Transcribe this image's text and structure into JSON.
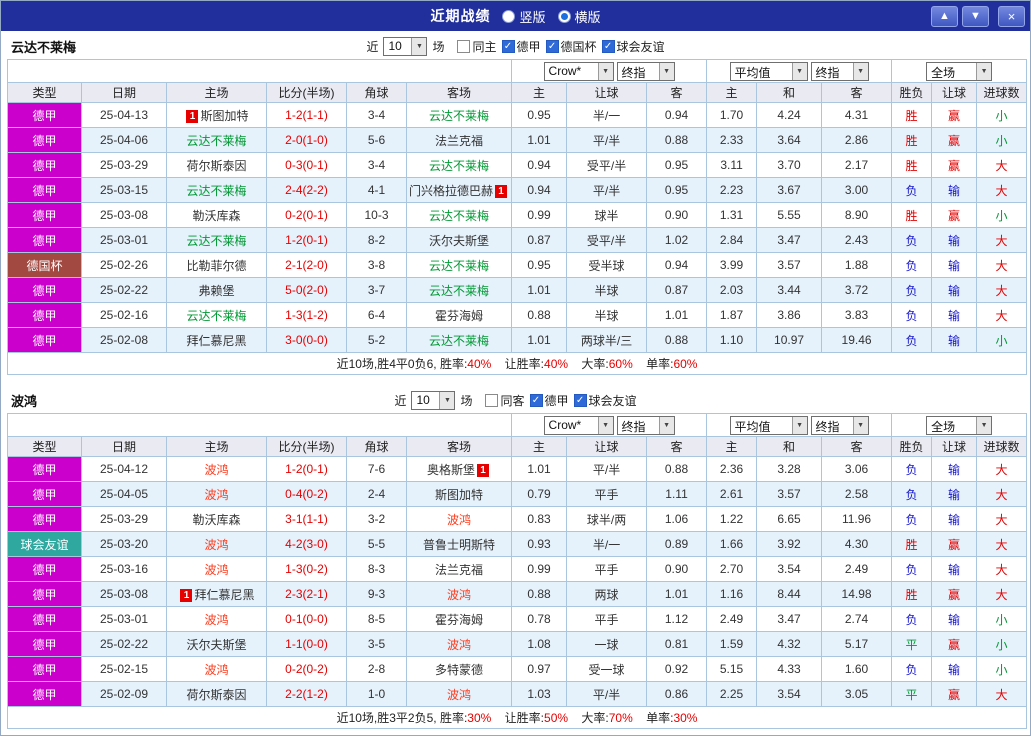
{
  "titlebar": {
    "title": "近期战绩",
    "vertical_label": "竖版",
    "horizontal_label": "横版",
    "up_icon": "▲",
    "down_icon": "▼",
    "close_icon": "×"
  },
  "filter_labels": {
    "recent": "近",
    "matches": "场"
  },
  "dropdowns": {
    "company": "Crow*",
    "stage": "终指",
    "average": "平均值",
    "stage2": "终指",
    "scope": "全场"
  },
  "columns": [
    "类型",
    "日期",
    "主场",
    "比分(半场)",
    "角球",
    "客场",
    "主",
    "让球",
    "客",
    "主",
    "和",
    "客",
    "胜负",
    "让球",
    "进球数"
  ],
  "colors": {
    "titlebar_bg": "#202f9b",
    "types": {
      "德甲": "#cc00cc",
      "德国杯": "#a24a42",
      "球会友谊": "#2fa8a0"
    },
    "score": "#e60000",
    "result": {
      "胜": "#e60000",
      "平": "#009933",
      "负": "#1515cc"
    },
    "cover": {
      "赢": "#e60000",
      "输": "#1515cc"
    },
    "goals": {
      "大": "#e60000",
      "小": "#009933"
    }
  },
  "sections": [
    {
      "team": "云达不莱梅",
      "team_color": "#009933",
      "recent_count": "10",
      "same_label": "同主",
      "leagues": [
        "德甲",
        "德国杯",
        "球会友谊"
      ],
      "rows": [
        {
          "type": "德甲",
          "date": "25-04-13",
          "home": "斯图加特",
          "home_badge": "1",
          "home_badge_pos": "before",
          "score": "1-2(1-1)",
          "corners": "3-4",
          "away": "云达不莱梅",
          "away_hl": true,
          "hcap_home": "0.95",
          "hcap_line": "半/一",
          "hcap_away": "0.94",
          "avg_home": "1.70",
          "avg_draw": "4.24",
          "avg_away": "4.31",
          "result": "胜",
          "hcap_result": "赢",
          "goals": "小"
        },
        {
          "type": "德甲",
          "date": "25-04-06",
          "home": "云达不莱梅",
          "home_hl": true,
          "score": "2-0(1-0)",
          "corners": "5-6",
          "away": "法兰克福",
          "hcap_home": "1.01",
          "hcap_line": "平/半",
          "hcap_away": "0.88",
          "avg_home": "2.33",
          "avg_draw": "3.64",
          "avg_away": "2.86",
          "result": "胜",
          "hcap_result": "赢",
          "goals": "小"
        },
        {
          "type": "德甲",
          "date": "25-03-29",
          "home": "荷尔斯泰因",
          "score": "0-3(0-1)",
          "corners": "3-4",
          "away": "云达不莱梅",
          "away_hl": true,
          "hcap_home": "0.94",
          "hcap_line": "受平/半",
          "hcap_away": "0.95",
          "avg_home": "3.11",
          "avg_draw": "3.70",
          "avg_away": "2.17",
          "result": "胜",
          "hcap_result": "赢",
          "goals": "大"
        },
        {
          "type": "德甲",
          "date": "25-03-15",
          "home": "云达不莱梅",
          "home_hl": true,
          "score": "2-4(2-2)",
          "corners": "4-1",
          "away": "门兴格拉德巴赫",
          "away_badge": "1",
          "away_badge_pos": "after",
          "hcap_home": "0.94",
          "hcap_line": "平/半",
          "hcap_away": "0.95",
          "avg_home": "2.23",
          "avg_draw": "3.67",
          "avg_away": "3.00",
          "result": "负",
          "hcap_result": "输",
          "goals": "大"
        },
        {
          "type": "德甲",
          "date": "25-03-08",
          "home": "勒沃库森",
          "score": "0-2(0-1)",
          "corners": "10-3",
          "away": "云达不莱梅",
          "away_hl": true,
          "hcap_home": "0.99",
          "hcap_line": "球半",
          "hcap_away": "0.90",
          "avg_home": "1.31",
          "avg_draw": "5.55",
          "avg_away": "8.90",
          "result": "胜",
          "hcap_result": "赢",
          "goals": "小"
        },
        {
          "type": "德甲",
          "date": "25-03-01",
          "home": "云达不莱梅",
          "home_hl": true,
          "score": "1-2(0-1)",
          "corners": "8-2",
          "away": "沃尔夫斯堡",
          "hcap_home": "0.87",
          "hcap_line": "受平/半",
          "hcap_away": "1.02",
          "avg_home": "2.84",
          "avg_draw": "3.47",
          "avg_away": "2.43",
          "result": "负",
          "hcap_result": "输",
          "goals": "大"
        },
        {
          "type": "德国杯",
          "date": "25-02-26",
          "home": "比勒菲尔德",
          "score": "2-1(2-0)",
          "corners": "3-8",
          "away": "云达不莱梅",
          "away_hl": true,
          "hcap_home": "0.95",
          "hcap_line": "受半球",
          "hcap_away": "0.94",
          "avg_home": "3.99",
          "avg_draw": "3.57",
          "avg_away": "1.88",
          "result": "负",
          "hcap_result": "输",
          "goals": "大"
        },
        {
          "type": "德甲",
          "date": "25-02-22",
          "home": "弗赖堡",
          "score": "5-0(2-0)",
          "corners": "3-7",
          "away": "云达不莱梅",
          "away_hl": true,
          "hcap_home": "1.01",
          "hcap_line": "半球",
          "hcap_away": "0.87",
          "avg_home": "2.03",
          "avg_draw": "3.44",
          "avg_away": "3.72",
          "result": "负",
          "hcap_result": "输",
          "goals": "大"
        },
        {
          "type": "德甲",
          "date": "25-02-16",
          "home": "云达不莱梅",
          "home_hl": true,
          "score": "1-3(1-2)",
          "corners": "6-4",
          "away": "霍芬海姆",
          "hcap_home": "0.88",
          "hcap_line": "半球",
          "hcap_away": "1.01",
          "avg_home": "1.87",
          "avg_draw": "3.86",
          "avg_away": "3.83",
          "result": "负",
          "hcap_result": "输",
          "goals": "大"
        },
        {
          "type": "德甲",
          "date": "25-02-08",
          "home": "拜仁慕尼黑",
          "score": "3-0(0-0)",
          "corners": "5-2",
          "away": "云达不莱梅",
          "away_hl": true,
          "hcap_home": "1.01",
          "hcap_line": "两球半/三",
          "hcap_away": "0.88",
          "avg_home": "1.10",
          "avg_draw": "10.97",
          "avg_away": "19.46",
          "result": "负",
          "hcap_result": "输",
          "goals": "小"
        }
      ],
      "summary": {
        "p1": "近10场,胜4平0负6, 胜率:",
        "v1": "40%",
        "p2": "让胜率:",
        "v2": "40%",
        "p3": "大率:",
        "v3": "60%",
        "p4": "单率:",
        "v4": "60%"
      }
    },
    {
      "team": "波鸿",
      "team_color": "#ff3a1a",
      "recent_count": "10",
      "same_label": "同客",
      "leagues": [
        "德甲",
        "球会友谊"
      ],
      "rows": [
        {
          "type": "德甲",
          "date": "25-04-12",
          "home": "波鸿",
          "home_hl": true,
          "score": "1-2(0-1)",
          "corners": "7-6",
          "away": "奥格斯堡",
          "away_badge": "1",
          "away_badge_pos": "after",
          "hcap_home": "1.01",
          "hcap_line": "平/半",
          "hcap_away": "0.88",
          "avg_home": "2.36",
          "avg_draw": "3.28",
          "avg_away": "3.06",
          "result": "负",
          "hcap_result": "输",
          "goals": "大"
        },
        {
          "type": "德甲",
          "date": "25-04-05",
          "home": "波鸿",
          "home_hl": true,
          "score": "0-4(0-2)",
          "corners": "2-4",
          "away": "斯图加特",
          "hcap_home": "0.79",
          "hcap_line": "平手",
          "hcap_away": "1.11",
          "avg_home": "2.61",
          "avg_draw": "3.57",
          "avg_away": "2.58",
          "result": "负",
          "hcap_result": "输",
          "goals": "大"
        },
        {
          "type": "德甲",
          "date": "25-03-29",
          "home": "勒沃库森",
          "score": "3-1(1-1)",
          "corners": "3-2",
          "away": "波鸿",
          "away_hl": true,
          "hcap_home": "0.83",
          "hcap_line": "球半/两",
          "hcap_away": "1.06",
          "avg_home": "1.22",
          "avg_draw": "6.65",
          "avg_away": "11.96",
          "result": "负",
          "hcap_result": "输",
          "goals": "大"
        },
        {
          "type": "球会友谊",
          "date": "25-03-20",
          "home": "波鸿",
          "home_hl": true,
          "score": "4-2(3-0)",
          "corners": "5-5",
          "away": "普鲁士明斯特",
          "hcap_home": "0.93",
          "hcap_line": "半/一",
          "hcap_away": "0.89",
          "avg_home": "1.66",
          "avg_draw": "3.92",
          "avg_away": "4.30",
          "result": "胜",
          "hcap_result": "赢",
          "goals": "大"
        },
        {
          "type": "德甲",
          "date": "25-03-16",
          "home": "波鸿",
          "home_hl": true,
          "score": "1-3(0-2)",
          "corners": "8-3",
          "away": "法兰克福",
          "hcap_home": "0.99",
          "hcap_line": "平手",
          "hcap_away": "0.90",
          "avg_home": "2.70",
          "avg_draw": "3.54",
          "avg_away": "2.49",
          "result": "负",
          "hcap_result": "输",
          "goals": "大"
        },
        {
          "type": "德甲",
          "date": "25-03-08",
          "home": "拜仁慕尼黑",
          "home_badge": "1",
          "home_badge_pos": "before",
          "score": "2-3(2-1)",
          "corners": "9-3",
          "away": "波鸿",
          "away_hl": true,
          "hcap_home": "0.88",
          "hcap_line": "两球",
          "hcap_away": "1.01",
          "avg_home": "1.16",
          "avg_draw": "8.44",
          "avg_away": "14.98",
          "result": "胜",
          "hcap_result": "赢",
          "goals": "大"
        },
        {
          "type": "德甲",
          "date": "25-03-01",
          "home": "波鸿",
          "home_hl": true,
          "score": "0-1(0-0)",
          "corners": "8-5",
          "away": "霍芬海姆",
          "hcap_home": "0.78",
          "hcap_line": "平手",
          "hcap_away": "1.12",
          "avg_home": "2.49",
          "avg_draw": "3.47",
          "avg_away": "2.74",
          "result": "负",
          "hcap_result": "输",
          "goals": "小"
        },
        {
          "type": "德甲",
          "date": "25-02-22",
          "home": "沃尔夫斯堡",
          "score": "1-1(0-0)",
          "corners": "3-5",
          "away": "波鸿",
          "away_hl": true,
          "hcap_home": "1.08",
          "hcap_line": "一球",
          "hcap_away": "0.81",
          "avg_home": "1.59",
          "avg_draw": "4.32",
          "avg_away": "5.17",
          "result": "平",
          "hcap_result": "赢",
          "goals": "小"
        },
        {
          "type": "德甲",
          "date": "25-02-15",
          "home": "波鸿",
          "home_hl": true,
          "score": "0-2(0-2)",
          "corners": "2-8",
          "away": "多特蒙德",
          "hcap_home": "0.97",
          "hcap_line": "受一球",
          "hcap_away": "0.92",
          "avg_home": "5.15",
          "avg_draw": "4.33",
          "avg_away": "1.60",
          "result": "负",
          "hcap_result": "输",
          "goals": "小"
        },
        {
          "type": "德甲",
          "date": "25-02-09",
          "home": "荷尔斯泰因",
          "score": "2-2(1-2)",
          "corners": "1-0",
          "away": "波鸿",
          "away_hl": true,
          "hcap_home": "1.03",
          "hcap_line": "平/半",
          "hcap_away": "0.86",
          "avg_home": "2.25",
          "avg_draw": "3.54",
          "avg_away": "3.05",
          "result": "平",
          "hcap_result": "赢",
          "goals": "大"
        }
      ],
      "summary": {
        "p1": "近10场,胜3平2负5, 胜率:",
        "v1": "30%",
        "p2": "让胜率:",
        "v2": "50%",
        "p3": "大率:",
        "v3": "70%",
        "p4": "单率:",
        "v4": "30%"
      }
    }
  ]
}
